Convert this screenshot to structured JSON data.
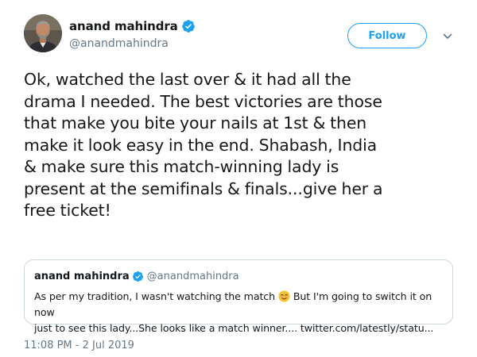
{
  "author": {
    "display_name": "anand mahindra",
    "handle": "@anandmahindra",
    "verified": true
  },
  "follow_button": {
    "label": "Follow"
  },
  "icons": {
    "verified": "verified-badge-icon",
    "menu": "chevron-down-icon",
    "emoji": "smiling-face-emoji"
  },
  "tweet": {
    "lines": [
      "Ok, watched the last over & it had all the",
      "drama I needed. The best victories are those",
      "that make you bite your nails at 1st & then",
      "make it look easy in the end. Shabash, India",
      "& make sure this match-winning lady is",
      "present at the semifinals & finals...give her a",
      "free ticket!"
    ],
    "timestamp": "11:08 PM - 2 Jul 2019"
  },
  "quoted_tweet": {
    "display_name": "anand mahindra",
    "handle": "@anandmahindra",
    "text_part1": "As per my tradition, I wasn't watching the match",
    "text_part2": "But I'm going to switch it on now",
    "text_line2": "just to see this lady...She looks like a match winner.... twitter.com/latestly/statu..."
  },
  "colors": {
    "accent": "#1da1f2",
    "text": "#14171a",
    "secondary": "#657786",
    "border": "#ccd6dd"
  }
}
